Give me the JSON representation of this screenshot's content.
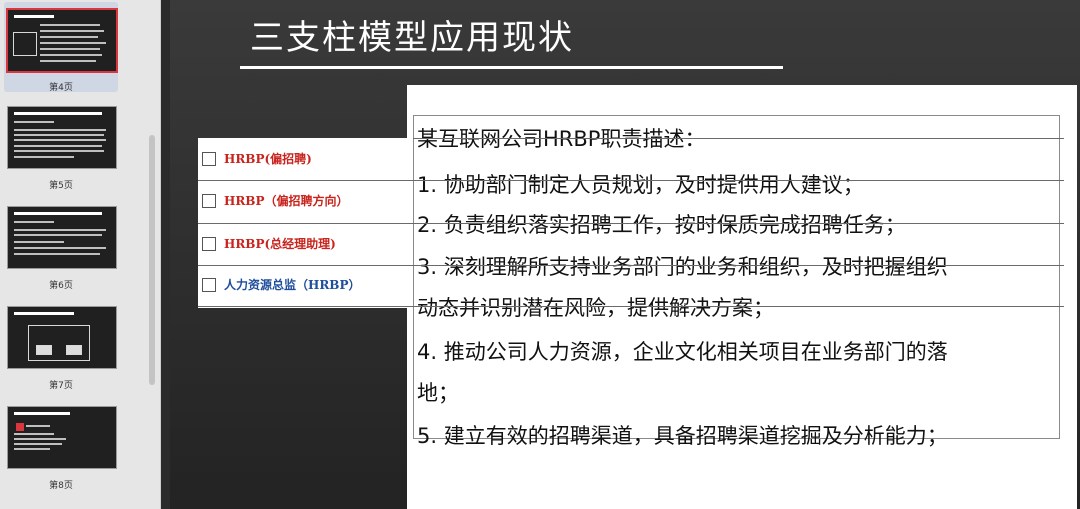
{
  "sidebar": {
    "slides": [
      {
        "label": "第4页"
      },
      {
        "label": "第5页"
      },
      {
        "label": "第6页"
      },
      {
        "label": "第7页"
      },
      {
        "label": "第8页"
      }
    ]
  },
  "slide": {
    "title": "三支柱模型应用现状",
    "options": [
      {
        "label": "HRBP(偏招聘)"
      },
      {
        "label": "HRBP（偏招聘方向）"
      },
      {
        "label": "HRBP(总经理助理)"
      },
      {
        "label": "人力资源总监（HRBP）"
      }
    ],
    "description": {
      "heading": "某互联网公司HRBP职责描述：",
      "lines": [
        "1. 协助部门制定人员规划，及时提供用人建议；",
        "2. 负责组织落实招聘工作，按时保质完成招聘任务；",
        "3. 深刻理解所支持业务部门的业务和组织，及时把握组织",
        "动态并识别潜在风险，提供解决方案；",
        "4. 推动公司人力资源，企业文化相关项目在业务部门的落",
        "地；",
        "5. 建立有效的招聘渠道，具备招聘渠道挖掘及分析能力；"
      ]
    }
  },
  "colors": {
    "accent_red": "#c8231c",
    "accent_blue": "#1f4e9c",
    "active_border": "#d9363e"
  }
}
